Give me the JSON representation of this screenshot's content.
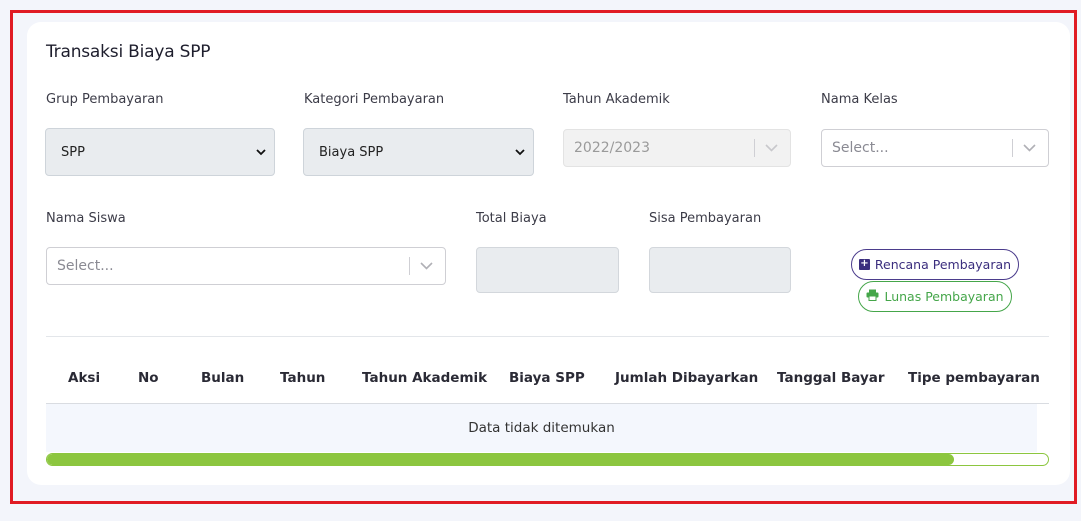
{
  "card": {
    "title": "Transaksi Biaya SPP"
  },
  "form": {
    "grup_label": "Grup Pembayaran",
    "grup_value": "SPP",
    "kategori_label": "Kategori Pembayaran",
    "kategori_value": "Biaya SPP",
    "tahun_label": "Tahun Akademik",
    "tahun_value": "2022/2023",
    "kelas_label": "Nama Kelas",
    "kelas_placeholder": "Select...",
    "siswa_label": "Nama Siswa",
    "siswa_placeholder": "Select...",
    "total_label": "Total Biaya",
    "total_value": "",
    "sisa_label": "Sisa Pembayaran",
    "sisa_value": ""
  },
  "buttons": {
    "rencana": "Rencana Pembayaran",
    "lunas": "Lunas Pembayaran"
  },
  "table": {
    "columns": [
      "Aksi",
      "No",
      "Bulan",
      "Tahun",
      "Tahun Akademik",
      "Biaya SPP",
      "Jumlah Dibayarkan",
      "Tanggal Bayar",
      "Tipe pembayaran"
    ],
    "empty_message": "Data tidak ditemukan"
  },
  "progress": {
    "value_percent": 90.6
  },
  "colors": {
    "accent": "#3b2e7e",
    "success": "#45a64a",
    "progress": "#8cc63f",
    "frame": "#e01b24"
  }
}
